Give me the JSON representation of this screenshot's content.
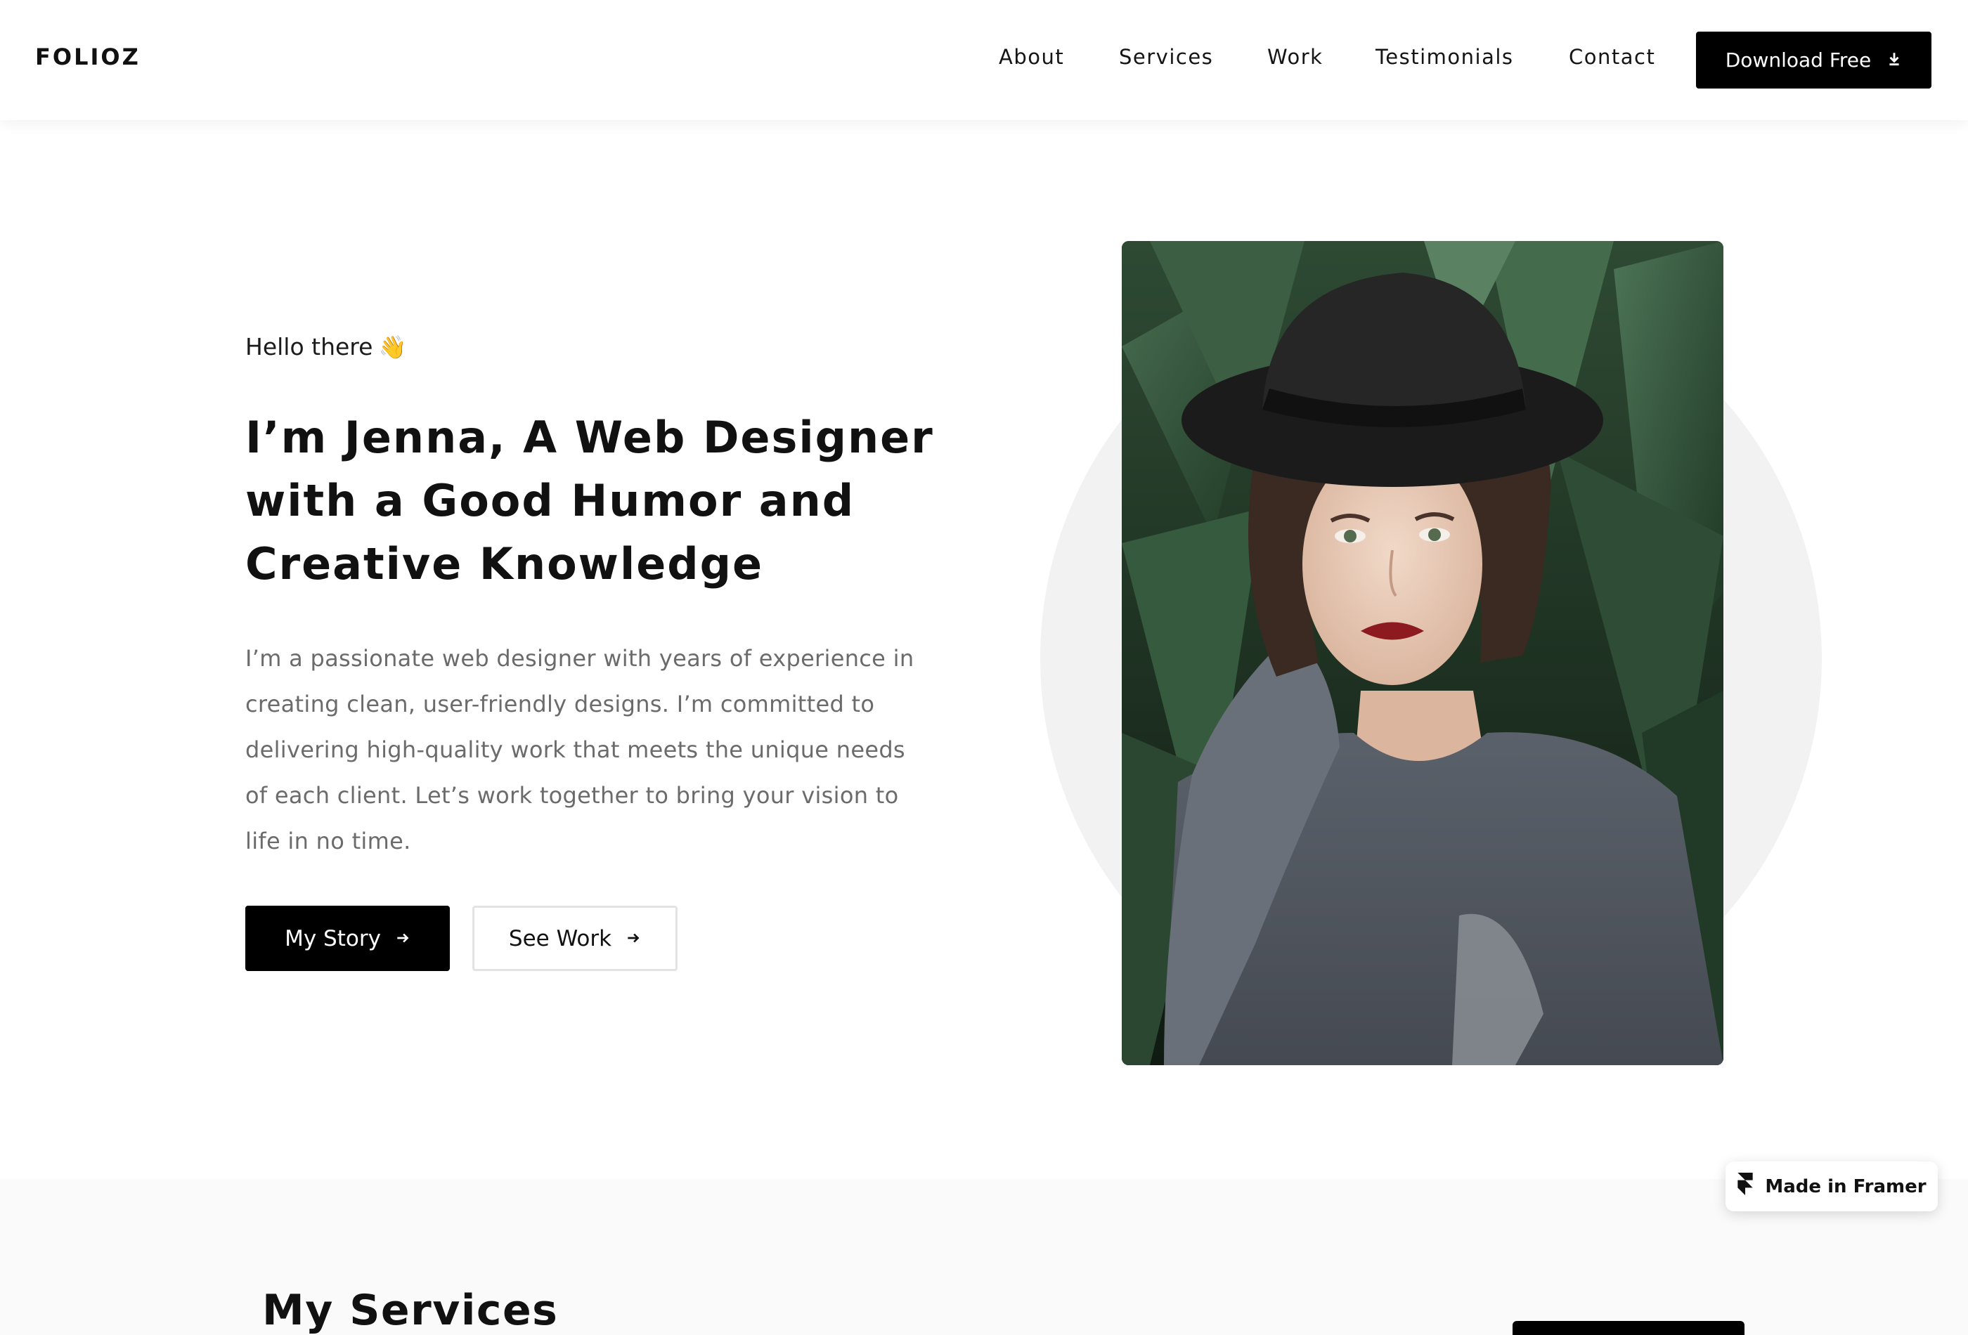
{
  "header": {
    "logo": "FOLIOZ",
    "nav": [
      {
        "label": "About"
      },
      {
        "label": "Services"
      },
      {
        "label": "Work"
      },
      {
        "label": "Testimonials"
      },
      {
        "label": "Contact"
      }
    ],
    "download_label": "Download Free",
    "download_icon": "download-icon"
  },
  "hero": {
    "greeting": "Hello there",
    "greeting_emoji": "👋",
    "headline_lines": [
      "I’m Jenna, A Web Designer",
      "with a Good Humor and",
      "Creative Knowledge"
    ],
    "bio_lines": [
      "I’m a passionate web designer with years of experience in",
      "creating clean, user-friendly designs. I’m committed to",
      "delivering high-quality work that meets the unique needs",
      "of each client. Let’s work together to bring your vision to",
      "life in no time."
    ],
    "primary_button": "My Story",
    "secondary_button": "See Work",
    "button_icon": "arrow-right-icon"
  },
  "services": {
    "title": "My Services"
  },
  "badge": {
    "label": "Made in Framer",
    "icon": "framer-logo-icon"
  },
  "colors": {
    "accent": "#000000",
    "text": "#111111",
    "muted_text": "#6b6b6b",
    "circle_bg": "#f2f2f2",
    "section_bg": "#fafafa"
  }
}
